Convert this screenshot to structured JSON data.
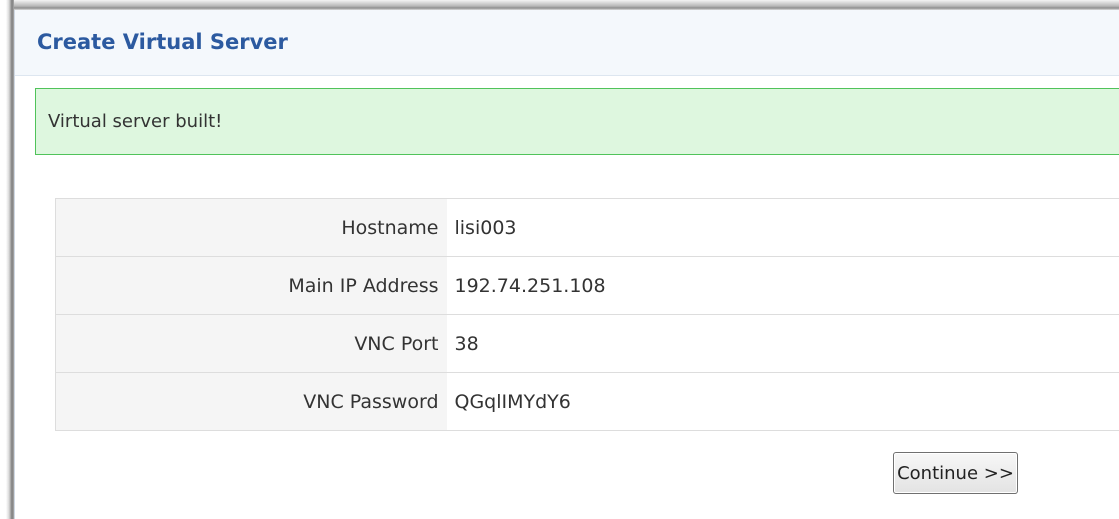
{
  "panel": {
    "title": "Create Virtual Server"
  },
  "alert": {
    "message": "Virtual server built!",
    "status_color": "#50c35a",
    "background_color": "#def7df"
  },
  "details": {
    "rows": [
      {
        "label": "Hostname",
        "value": "lisi003"
      },
      {
        "label": "Main IP Address",
        "value": "192.74.251.108"
      },
      {
        "label": "VNC Port",
        "value": "38"
      },
      {
        "label": "VNC Password",
        "value": "QGqlIMYdY6"
      }
    ]
  },
  "actions": {
    "continue_label": "Continue >>"
  },
  "colors": {
    "title": "#2c5aa0",
    "header_background": "#f4f8fc"
  }
}
